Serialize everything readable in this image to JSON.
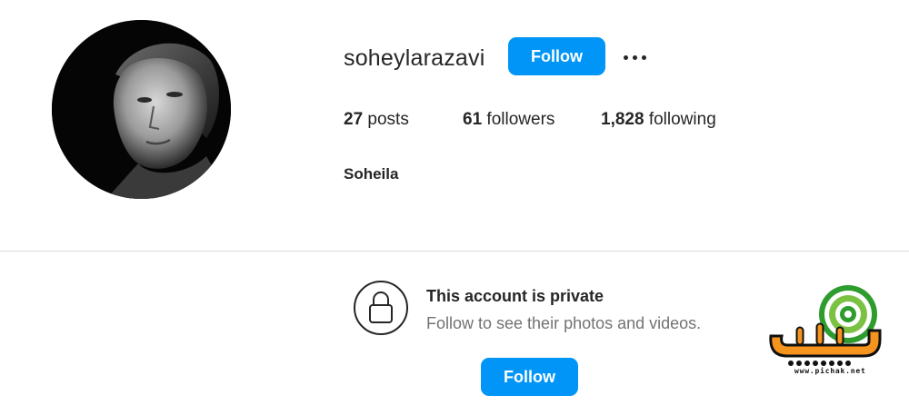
{
  "profile": {
    "username": "soheylarazavi",
    "full_name": "Soheila",
    "follow_label": "Follow",
    "more_icon": "more-options-icon",
    "stats": {
      "posts_count": "27",
      "posts_label": "posts",
      "followers_count": "61",
      "followers_label": "followers",
      "following_count": "1,828",
      "following_label": "following"
    }
  },
  "private_notice": {
    "icon": "lock-icon",
    "title": "This account is private",
    "subtitle": "Follow to see their photos and videos.",
    "follow_label": "Follow"
  },
  "watermark": {
    "url": "www.pichak.net",
    "logo": "pichak-logo"
  },
  "colors": {
    "accent": "#0095f6",
    "text": "#262626",
    "secondary_text": "#737373",
    "divider": "#dbdbdb"
  }
}
